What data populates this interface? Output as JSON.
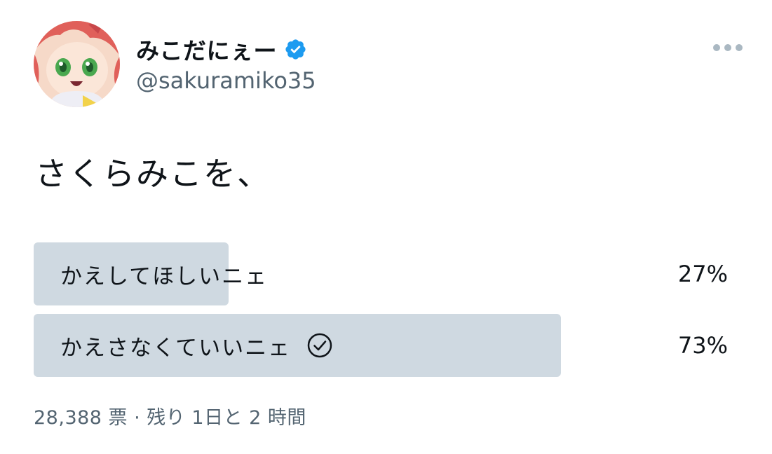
{
  "author": {
    "display_name": "みこだにぇー",
    "handle": "@sakuramiko35",
    "verified": true,
    "avatar_icon": "avatar-image"
  },
  "more_icon": "more-horizontal-icon",
  "tweet": {
    "text": "さくらみこを、"
  },
  "poll": {
    "options": [
      {
        "label": "かえしてほしいニェ",
        "percent": "27%",
        "fraction": 0.27,
        "selected": false
      },
      {
        "label": "かえさなくていいニェ",
        "percent": "73%",
        "fraction": 0.73,
        "selected": true
      }
    ],
    "bar_color": "#cfd9e1",
    "meta": "28,388 票 · 残り 1日と 2 時間"
  },
  "colors": {
    "verified": "#1d9bf0",
    "secondary_text": "#536471"
  }
}
